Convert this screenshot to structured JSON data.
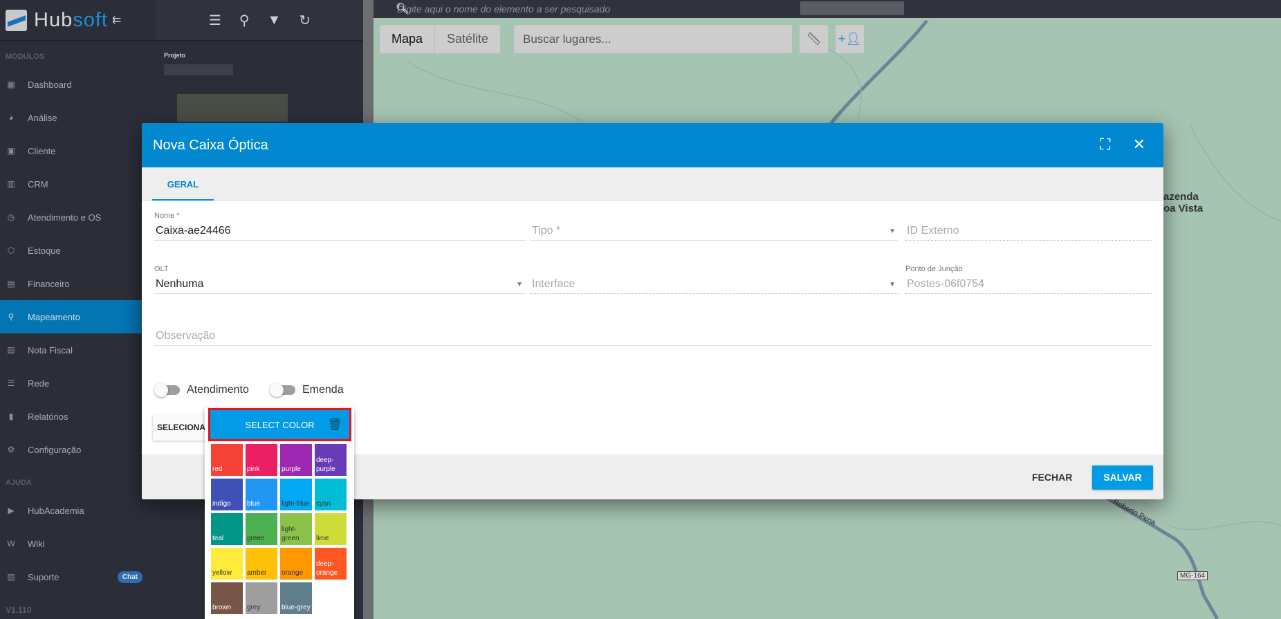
{
  "sidebar": {
    "brand_prefix": "Hub",
    "brand_suffix": "soft",
    "modules_heading": "MÓDULOS",
    "items": [
      {
        "label": "Dashboard",
        "icon": "dashboard-icon",
        "glyph": "▦"
      },
      {
        "label": "Análise",
        "icon": "pie-chart-icon",
        "glyph": "◕"
      },
      {
        "label": "Cliente",
        "icon": "contact-card-icon",
        "glyph": "▣",
        "chevron": true
      },
      {
        "label": "CRM",
        "icon": "trello-board-icon",
        "glyph": "▥"
      },
      {
        "label": "Atendimento e OS",
        "icon": "calendar-clock-icon",
        "glyph": "◷"
      },
      {
        "label": "Estoque",
        "icon": "box-icon",
        "glyph": "⬡"
      },
      {
        "label": "Financeiro",
        "icon": "money-icon",
        "glyph": "▤"
      },
      {
        "label": "Mapeamento",
        "icon": "map-pin-icon",
        "glyph": "⚲",
        "active": true
      },
      {
        "label": "Nota Fiscal",
        "icon": "document-icon",
        "glyph": "▤"
      },
      {
        "label": "Rede",
        "icon": "server-icon",
        "glyph": "☰"
      },
      {
        "label": "Relatórios",
        "icon": "file-icon",
        "glyph": "▮"
      },
      {
        "label": "Configuração",
        "icon": "gear-icon",
        "glyph": "⚙",
        "chevron": true
      }
    ],
    "help_heading": "AJUDA",
    "help_items": [
      {
        "label": "HubAcademia",
        "icon": "youtube-icon",
        "glyph": "▶"
      },
      {
        "label": "Wiki",
        "icon": "wikipedia-icon",
        "glyph": "W"
      },
      {
        "label": "Suporte",
        "icon": "chat-icon",
        "glyph": "▤",
        "badge": "Chat"
      }
    ],
    "version": "V1.110"
  },
  "panel": {
    "project_label": "Projeto"
  },
  "map": {
    "search_placeholder": "Digite aqui o nome do elemento a ser pesquisado",
    "type_map": "Mapa",
    "type_satellite": "Satélite",
    "places_placeholder": "Buscar lugares...",
    "labels": {
      "farm_1": "azenda",
      "farm_2": "oa Vista",
      "road": "Roberto Pena",
      "highway": "MG-164"
    },
    "bg_color": "#a6c4b2"
  },
  "dialog": {
    "title": "Nova Caixa Óptica",
    "tab": "GERAL",
    "fields": {
      "nome_label": "Nome *",
      "nome_value": "Caixa-ae24466",
      "tipo_placeholder": "Tipo *",
      "id_externo_placeholder": "ID Externo",
      "olt_label": "OLT",
      "olt_value": "Nenhuma",
      "interface_placeholder": "Interface",
      "ponto_label": "Ponto de Junção",
      "ponto_value": "Postes-06f0754",
      "observacao_placeholder": "Observação"
    },
    "toggles": {
      "atendimento": "Atendimento",
      "emenda": "Emenda"
    },
    "select_button": "SELECIONAR",
    "close_button": "FECHAR",
    "save_button": "SALVAR",
    "accent": "#0288d1"
  },
  "color_picker": {
    "button_label": "SELECT COLOR",
    "swatches": [
      {
        "name": "red",
        "color": "#f44336",
        "text": "#fff"
      },
      {
        "name": "pink",
        "color": "#e91e63",
        "text": "#fff"
      },
      {
        "name": "purple",
        "color": "#9c27b0",
        "text": "#fff"
      },
      {
        "name": "deep-purple",
        "color": "#673ab7",
        "text": "#fff"
      },
      {
        "name": "indigo",
        "color": "#3f51b5",
        "text": "#fff"
      },
      {
        "name": "blue",
        "color": "#2196f3",
        "text": "#fff"
      },
      {
        "name": "light-blue",
        "color": "#03a9f4",
        "text": "#333"
      },
      {
        "name": "cyan",
        "color": "#00bcd4",
        "text": "#333"
      },
      {
        "name": "teal",
        "color": "#009688",
        "text": "#fff"
      },
      {
        "name": "green",
        "color": "#4caf50",
        "text": "#333"
      },
      {
        "name": "light-green",
        "color": "#8bc34a",
        "text": "#333"
      },
      {
        "name": "lime",
        "color": "#cddc39",
        "text": "#333"
      },
      {
        "name": "yellow",
        "color": "#ffeb3b",
        "text": "#333"
      },
      {
        "name": "amber",
        "color": "#ffc107",
        "text": "#333"
      },
      {
        "name": "orange",
        "color": "#ff9800",
        "text": "#333"
      },
      {
        "name": "deep-orange",
        "color": "#ff5722",
        "text": "#fff"
      },
      {
        "name": "brown",
        "color": "#795548",
        "text": "#fff"
      },
      {
        "name": "grey",
        "color": "#9e9e9e",
        "text": "#333"
      },
      {
        "name": "blue-grey",
        "color": "#607d8b",
        "text": "#fff"
      }
    ]
  }
}
